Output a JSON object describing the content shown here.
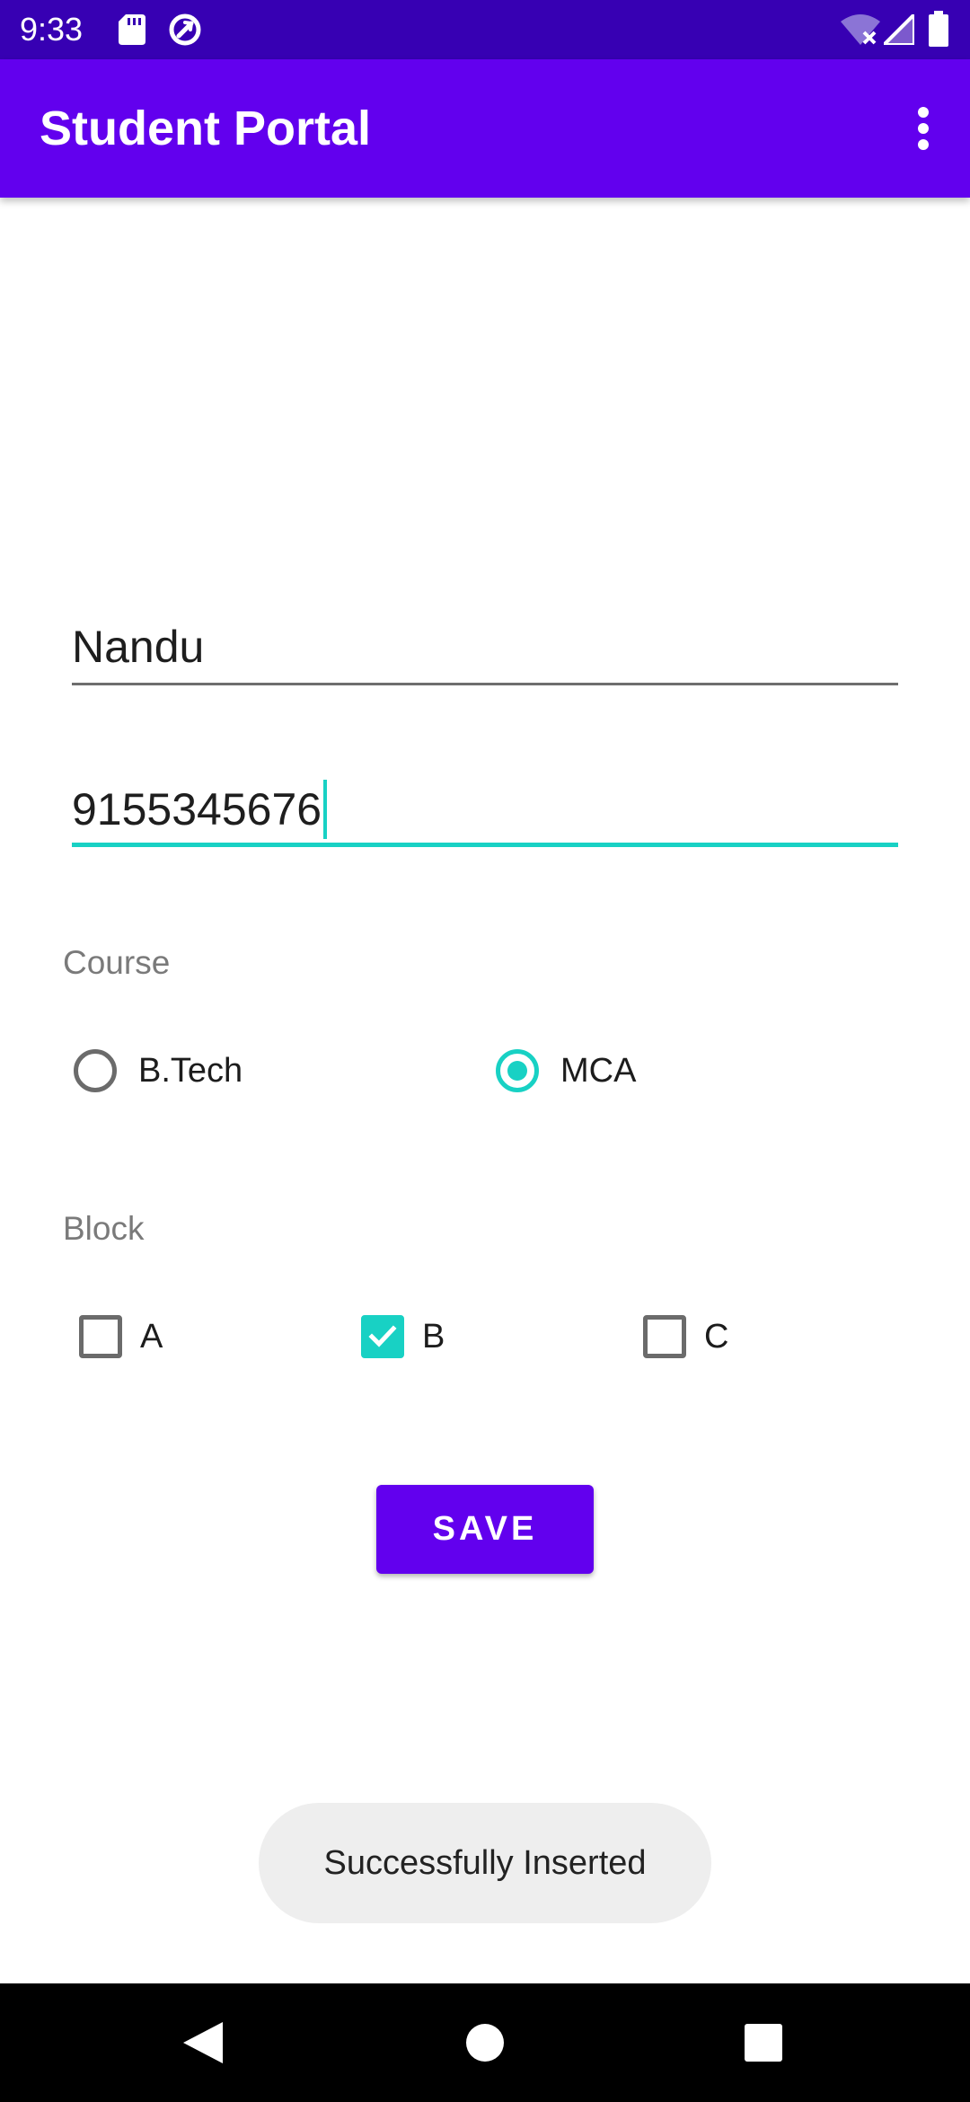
{
  "status_bar": {
    "time": "9:33",
    "icons": [
      "sd-card-icon",
      "sync-icon",
      "wifi-off-icon",
      "signal-icon",
      "battery-icon"
    ],
    "background": "#3700b3"
  },
  "app_bar": {
    "title": "Student Portal",
    "overflow_icon": "more-vert-icon",
    "background": "#6200ee"
  },
  "form": {
    "name_value": "Nandu",
    "phone_value": "9155345676",
    "course": {
      "label": "Course",
      "options": [
        {
          "label": "B.Tech",
          "selected": false
        },
        {
          "label": "MCA",
          "selected": true
        }
      ]
    },
    "block": {
      "label": "Block",
      "options": [
        {
          "label": "A",
          "checked": false
        },
        {
          "label": "B",
          "checked": true
        },
        {
          "label": "C",
          "checked": false
        }
      ]
    },
    "save_label": "SAVE"
  },
  "toast": {
    "message": "Successfully Inserted"
  },
  "nav_bar": {
    "icons": [
      "back-icon",
      "home-icon",
      "recents-icon"
    ]
  },
  "colors": {
    "primary": "#6200ee",
    "primary_dark": "#3700b3",
    "accent": "#18d1c4"
  }
}
